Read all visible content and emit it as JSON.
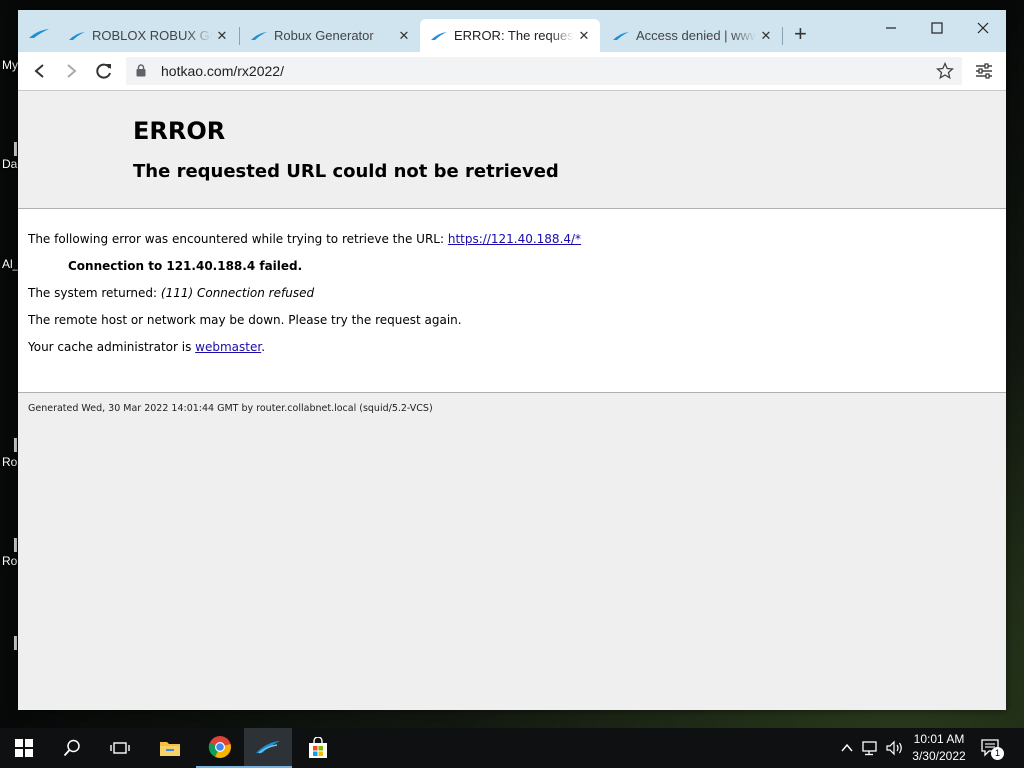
{
  "desktop": {
    "labels": [
      "My",
      "Da",
      "Al_",
      "Ro",
      "Ro"
    ]
  },
  "browser": {
    "tabs": [
      {
        "title": "ROBLOX ROBUX GENERATOR",
        "active": false,
        "close": "✕"
      },
      {
        "title": "Robux Generator",
        "active": false,
        "close": "✕"
      },
      {
        "title": "ERROR: The requested URL",
        "active": true,
        "close": "✕"
      },
      {
        "title": "Access denied | www",
        "active": false,
        "close": "✕"
      }
    ],
    "new_tab_label": "+",
    "window_controls": {
      "minimize": "—",
      "maximize": "☐",
      "close": "✕"
    },
    "url": "hotkao.com/rx2022/"
  },
  "page": {
    "title": "ERROR",
    "subtitle": "The requested URL could not be retrieved",
    "line1_prefix": "The following error was encountered while trying to retrieve the URL: ",
    "line1_link": "https://121.40.188.4/*",
    "connection_failed": "Connection to 121.40.188.4 failed.",
    "system_returned_prefix": "The system returned: ",
    "system_returned_value": "(111) Connection refused",
    "remote_host": "The remote host or network may be down. Please try the request again.",
    "cache_admin_prefix": "Your cache administrator is ",
    "cache_admin_link": "webmaster",
    "cache_admin_suffix": ".",
    "footer": "Generated Wed, 30 Mar 2022 14:01:44 GMT by router.collabnet.local (squid/5.2-VCS)"
  },
  "taskbar": {
    "time": "10:01 AM",
    "date": "3/30/2022",
    "notification_count": "1",
    "icons": [
      "windows-start-icon",
      "search-icon",
      "task-view-icon",
      "file-explorer-icon",
      "chrome-icon",
      "browser-app-icon",
      "store-icon"
    ]
  },
  "colors": {
    "tabbar": "#cfe4ef",
    "link": "#1a0dab",
    "taskbar": "#0e1012",
    "active_indicator": "#7ab3e0"
  }
}
